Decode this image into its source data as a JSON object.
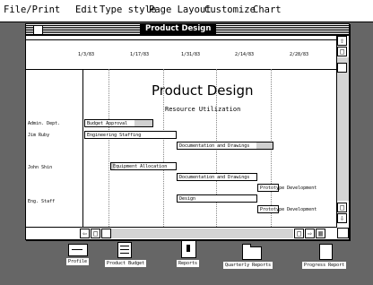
{
  "menubar": {
    "items": [
      "File/Print",
      "Edit",
      "Type style",
      "Page Layout",
      "Customize",
      "Chart"
    ]
  },
  "window": {
    "title": "Product Design",
    "dates": [
      "1/3/83",
      "1/17/83",
      "1/31/83",
      "2/14/83",
      "2/28/83"
    ],
    "chart_title": "Product Design",
    "chart_subtitle": "Resource Utilization",
    "resources": [
      "Admin. Dept.",
      "Jim Ruby",
      "John Shin",
      "Eng. Staff"
    ],
    "tasks": [
      "Budget Approval",
      "Engineering Staffing",
      "Documentation and Drawings",
      "Equipment Allocation",
      "Documentation and Drawings",
      "Prototype Development",
      "Design",
      "Prototype Development"
    ]
  },
  "desktop_icons": [
    {
      "label": "Profile",
      "icon": "profile-icon"
    },
    {
      "label": "Product Budget",
      "icon": "spreadsheet-icon"
    },
    {
      "label": "Reports",
      "icon": "report-icon"
    },
    {
      "label": "Quarterly Reports",
      "icon": "folder-icon"
    },
    {
      "label": "Progress Report",
      "icon": "page-icon"
    }
  ]
}
